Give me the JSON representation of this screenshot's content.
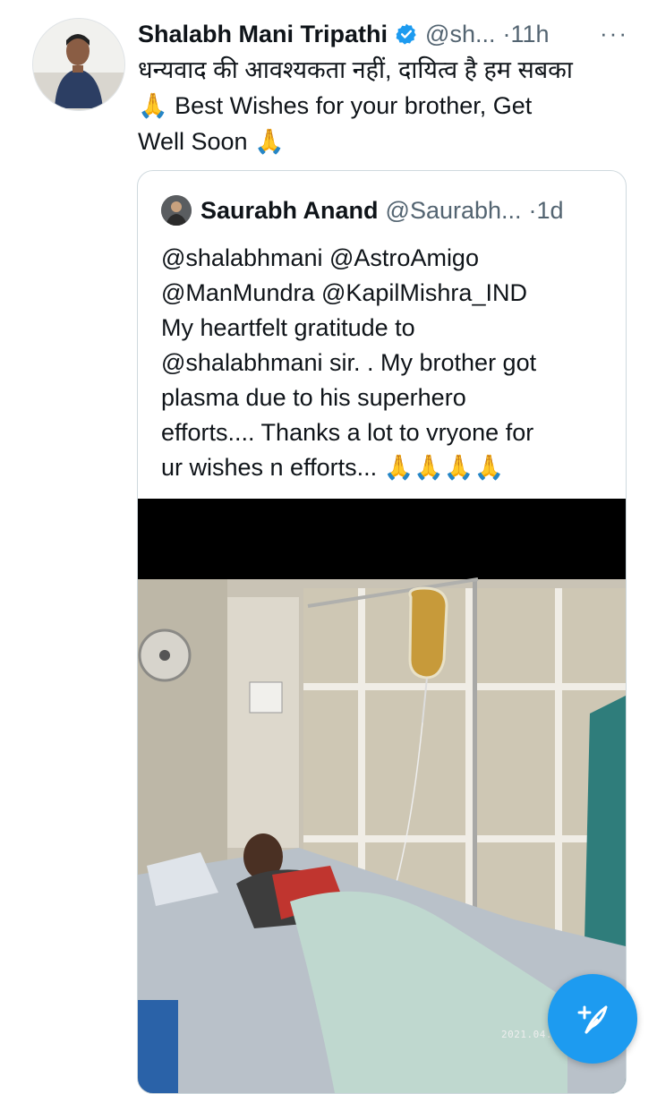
{
  "tweet": {
    "author_name": "Shalabh Mani Tripathi",
    "handle": "@sh...",
    "time": "·11h",
    "more_icon": "more-horizontal-icon",
    "text_lines": [
      "धन्यवाद की आवश्यकता नहीं, दायित्व है हम सबका",
      "🙏 Best Wishes for your brother, Get",
      "Well Soon 🙏"
    ]
  },
  "quoted": {
    "author_name": "Saurabh Anand",
    "handle": "@Saurabh...",
    "time": "·1d",
    "text_lines": [
      "@shalabhmani @AstroAmigo",
      "@ManMundra @KapilMishra_IND",
      "My heartfelt gratitude to",
      "@shalabhmani sir. . My brother got",
      "plasma due to his superhero",
      "efforts.... Thanks a lot to vryone for",
      "ur wishes n efforts... 🙏🙏🙏🙏"
    ],
    "media_timestamp": "2021.04.17"
  },
  "compose_button_icon": "compose-feather-icon",
  "colors": {
    "accent": "#1d9bf0",
    "secondary_text": "#536471",
    "border": "#cfd9de"
  }
}
